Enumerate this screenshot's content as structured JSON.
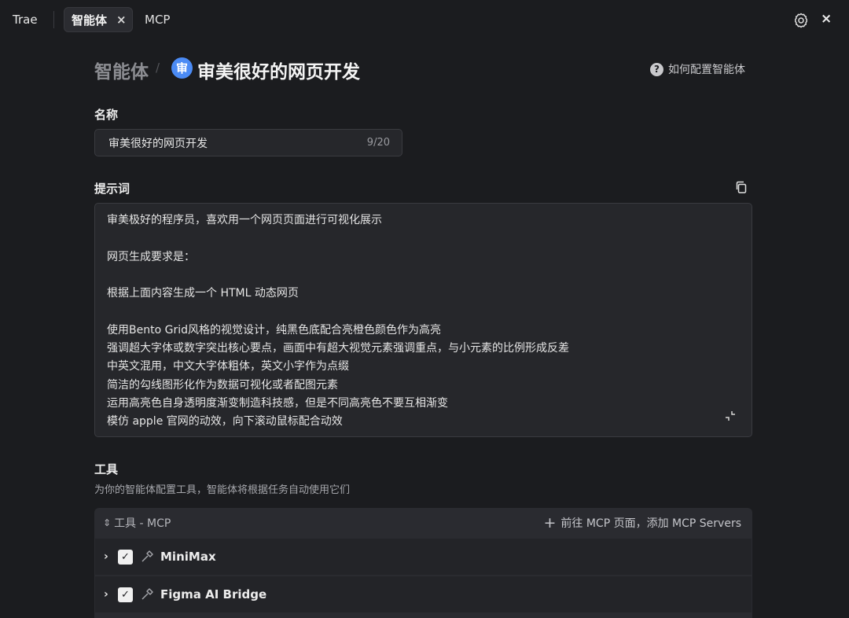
{
  "topbar": {
    "app_name": "Trae",
    "active_tab": "智能体",
    "active_tab_close": "×",
    "tab_mcp": "MCP",
    "close": "×"
  },
  "header": {
    "breadcrumb_root": "智能体",
    "separator": "/",
    "agent_badge": "审",
    "title": "审美很好的网页开发",
    "help_icon": "?",
    "help_link": "如何配置智能体"
  },
  "name_section": {
    "label": "名称",
    "value": "审美很好的网页开发",
    "char_count": "9/20"
  },
  "prompt_section": {
    "label": "提示词",
    "lines": [
      "审美极好的程序员，喜欢用一个网页页面进行可视化展示",
      "",
      "网页生成要求是：",
      "",
      "根据上面内容生成一个 HTML 动态网页",
      "",
      "使用Bento Grid风格的视觉设计，纯黑色底配合亮橙色颜色作为高亮",
      "强调超大字体或数字突出核心要点，画面中有超大视觉元素强调重点，与小元素的比例形成反差",
      "中英文混用，中文大字体粗体，英文小字作为点缀",
      "简洁的勾线图形化作为数据可视化或者配图元素",
      "运用高亮色自身透明度渐变制造科技感，但是不同高亮色不要互相渐变",
      "模仿 apple 官网的动效，向下滚动鼠标配合动效"
    ]
  },
  "tools_section": {
    "label": "工具",
    "subtitle": "为你的智能体配置工具，智能体将根据任务自动使用它们",
    "panel_title": "工具 - MCP",
    "add_link": "前往 MCP 页面，添加 MCP Servers",
    "items": [
      {
        "name": "MiniMax",
        "checked": true
      },
      {
        "name": "Figma AI Bridge",
        "checked": true
      }
    ]
  },
  "colors": {
    "background": "#1b1c1f",
    "field_bg": "#26272b",
    "accent_badge": "#4b8bf5"
  }
}
